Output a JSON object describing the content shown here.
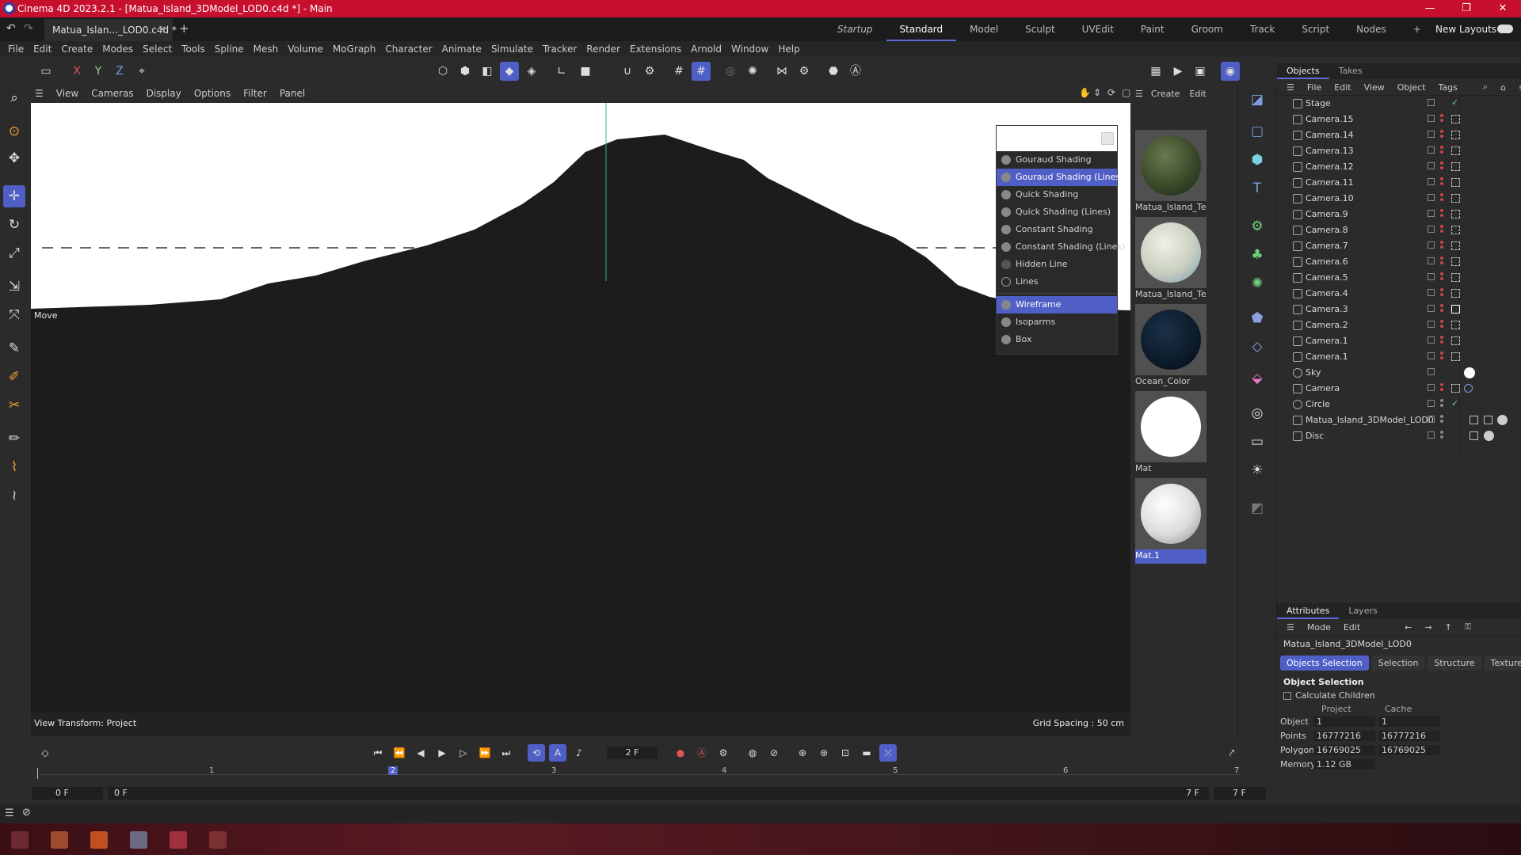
{
  "window": {
    "title": "Cinema 4D 2023.2.1 - [Matua_Island_3DModel_LOD0.c4d *] - Main",
    "controls": [
      "—",
      "❐",
      "✕"
    ]
  },
  "tabbar": {
    "doc_tab": "Matua_Islan..._LOD0.c4d *",
    "add": "+",
    "layouts": [
      "Startup",
      "Standard",
      "Model",
      "Sculpt",
      "UVEdit",
      "Paint",
      "Groom",
      "Track",
      "Script",
      "Nodes"
    ],
    "active_layout": "Standard",
    "new_layouts": "New Layouts"
  },
  "menubar": [
    "File",
    "Edit",
    "Create",
    "Modes",
    "Select",
    "Tools",
    "Spline",
    "Mesh",
    "Volume",
    "MoGraph",
    "Character",
    "Animate",
    "Simulate",
    "Tracker",
    "Render",
    "Extensions",
    "Arnold",
    "Window",
    "Help"
  ],
  "toolbar": {
    "axes": [
      "X",
      "Y",
      "Z"
    ]
  },
  "viewport": {
    "menu": [
      "View",
      "Cameras",
      "Display",
      "Options",
      "Filter",
      "Panel"
    ],
    "move_label": "Move",
    "view_transform": "View Transform: Project",
    "grid_spacing": "Grid Spacing : 50 cm"
  },
  "shading_menu": {
    "items": [
      "Gouraud Shading",
      "Gouraud Shading (Lines)",
      "Quick Shading",
      "Quick Shading (Lines)",
      "Constant Shading",
      "Constant Shading (Lines)",
      "Hidden Line",
      "Lines"
    ],
    "items2": [
      "Wireframe",
      "Isoparms",
      "Box"
    ],
    "selected": "Gouraud Shading (Lines)",
    "selected2": "Wireframe"
  },
  "materials": {
    "menu": [
      "Create",
      "Edit"
    ],
    "items": [
      {
        "name": "Matua_Island_Text",
        "color": "#4a5a3a"
      },
      {
        "name": "Matua_Island_Text",
        "color": "#c9cfbf"
      },
      {
        "name": "Ocean_Color",
        "color": "#0c1b2a"
      },
      {
        "name": "Mat",
        "color": "#ffffff"
      },
      {
        "name": "Mat.1",
        "color": "#dcdcdc"
      }
    ]
  },
  "objects": {
    "tabs": [
      "Objects",
      "Takes"
    ],
    "menu": [
      "File",
      "Edit",
      "View",
      "Object",
      "Tags"
    ],
    "rows": [
      "Stage",
      "Camera.15",
      "Camera.14",
      "Camera.13",
      "Camera.12",
      "Camera.11",
      "Camera.10",
      "Camera.9",
      "Camera.8",
      "Camera.7",
      "Camera.6",
      "Camera.5",
      "Camera.4",
      "Camera.3",
      "Camera.2",
      "Camera.1",
      "Camera.1",
      "Sky",
      "Camera",
      "Circle",
      "Matua_Island_3DModel_LOD0",
      "Disc"
    ]
  },
  "attributes": {
    "tabs": [
      "Attributes",
      "Layers"
    ],
    "menu": [
      "Mode",
      "Edit"
    ],
    "object_name": "Matua_Island_3DModel_LOD0",
    "sub_tabs": [
      "Objects Selection",
      "Selection",
      "Structure",
      "Textures"
    ],
    "section": "Object Selection",
    "calc_children": "Calculate Children",
    "col_project": "Project",
    "col_cache": "Cache",
    "rows": [
      {
        "label": "Object",
        "project": "1",
        "cache": "1"
      },
      {
        "label": "Points",
        "project": "16777216",
        "cache": "16777216"
      },
      {
        "label": "Polygons",
        "project": "16769025",
        "cache": "16769025"
      },
      {
        "label": "Memory",
        "project": "1.12 GB",
        "cache": ""
      }
    ]
  },
  "timeline": {
    "current_frame": "2 F",
    "ticks": [
      "1",
      "2",
      "3",
      "4",
      "5",
      "6",
      "7"
    ],
    "start": "0 F",
    "start2": "0 F",
    "end": "7 F",
    "end2": "7 F"
  }
}
